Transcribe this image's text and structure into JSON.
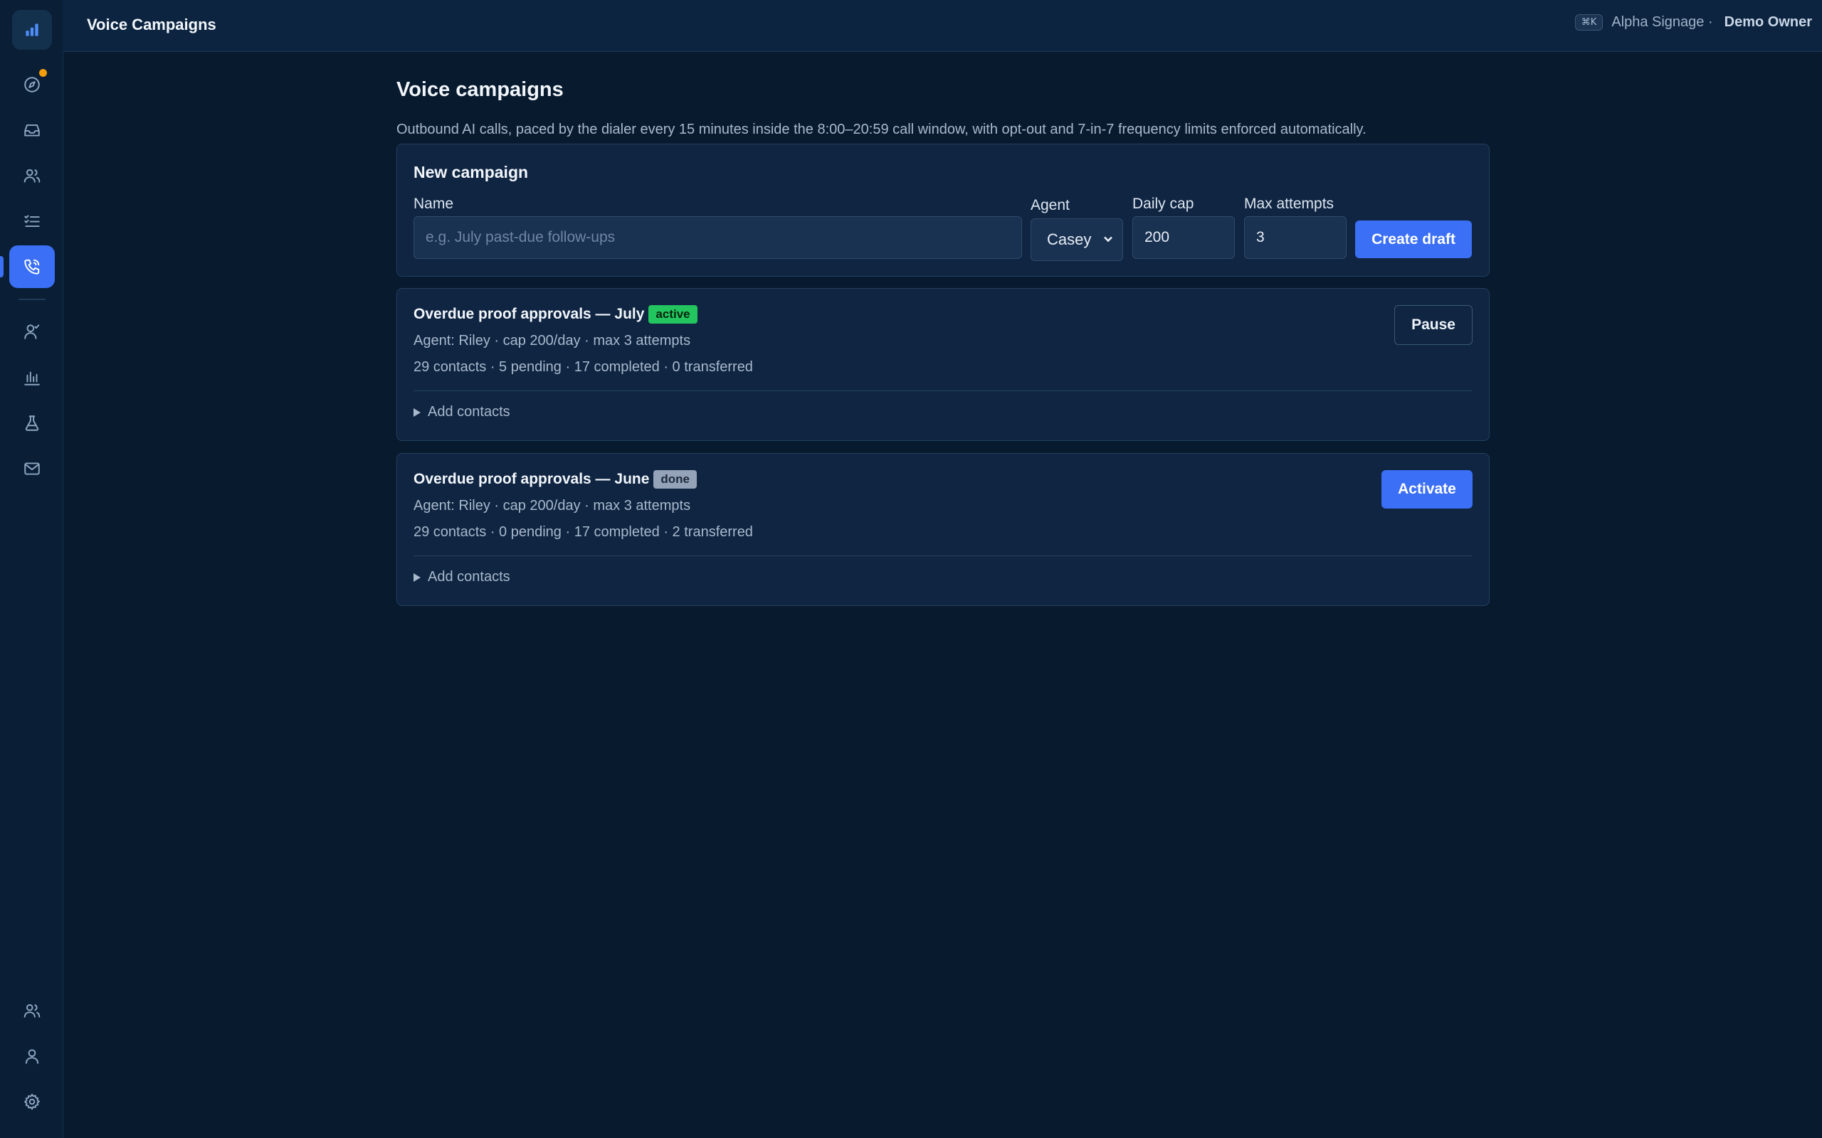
{
  "topbar": {
    "title": "Voice Campaigns",
    "shortcut": "⌘K",
    "org": "Alpha Signage ·",
    "user": "Demo Owner"
  },
  "sidebar": {
    "items": [
      {
        "icon": "bar-chart-logo-icon"
      },
      {
        "icon": "compass-icon",
        "notification": true
      },
      {
        "icon": "inbox-icon"
      },
      {
        "icon": "users-icon"
      },
      {
        "icon": "checklist-icon"
      },
      {
        "icon": "phone-call-icon",
        "active": true
      },
      {
        "icon": "user-check-icon"
      },
      {
        "icon": "bar-chart-icon"
      },
      {
        "icon": "flask-icon"
      },
      {
        "icon": "mail-icon"
      },
      {
        "icon": "team-icon"
      },
      {
        "icon": "user-icon"
      },
      {
        "icon": "gear-icon"
      }
    ],
    "accent": "#3b6ff5"
  },
  "page": {
    "title": "Voice campaigns",
    "description": "Outbound AI calls, paced by the dialer every 15 minutes inside the 8:00–20:59 call window, with opt-out and 7-in-7 frequency limits enforced automatically."
  },
  "new_campaign": {
    "heading": "New campaign",
    "name_label": "Name",
    "name_placeholder": "e.g. July past-due follow-ups",
    "name_value": "",
    "agent_label": "Agent",
    "agent_value": "Casey",
    "daily_cap_label": "Daily cap",
    "daily_cap_value": "200",
    "max_attempts_label": "Max attempts",
    "max_attempts_value": "3",
    "create_button": "Create draft"
  },
  "campaigns": [
    {
      "name": "Overdue proof approvals — July",
      "status": "active",
      "status_color": "#22c55e",
      "config": "Agent: Riley · cap 200/day · max 3 attempts",
      "stats": "29 contacts · 5 pending · 17 completed · 0 transferred",
      "action": "Pause",
      "details_label": "Add contacts"
    },
    {
      "name": "Overdue proof approvals — June",
      "status": "done",
      "status_color": "#94a3b8",
      "config": "Agent: Riley · cap 200/day · max 3 attempts",
      "stats": "29 contacts · 0 pending · 17 completed · 2 transferred",
      "action": "Activate",
      "details_label": "Add contacts"
    }
  ]
}
